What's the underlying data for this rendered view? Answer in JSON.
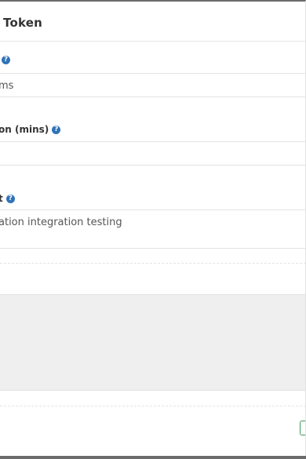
{
  "modal": {
    "title": "Token",
    "fields": [
      {
        "label": "",
        "value": "ms"
      },
      {
        "label": "on (mins)",
        "value": ""
      },
      {
        "label": "t",
        "value": "ation integration testing"
      }
    ]
  },
  "colors": {
    "help_icon": "#2f73b8",
    "footer_button_border": "#3a9d5d",
    "backdrop": "#6b6b6b",
    "code_area": "#efefef"
  },
  "icons": {
    "help": "question-circle-icon"
  }
}
